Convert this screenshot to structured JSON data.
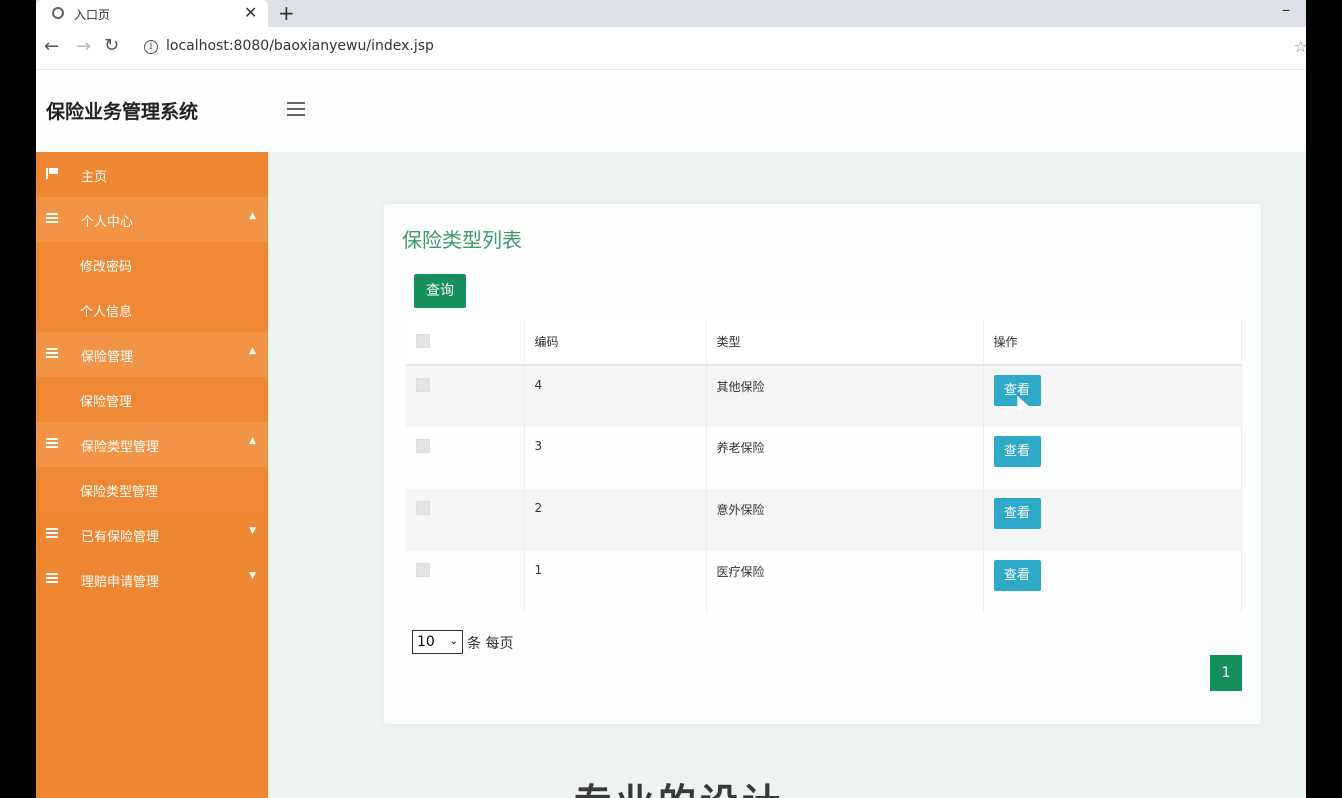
{
  "browser": {
    "tab_title": "入口页",
    "url": "localhost:8080/baoxianyewu/index.jsp"
  },
  "app": {
    "title": "保险业务管理系统"
  },
  "sidebar": {
    "items": [
      {
        "label": "主页",
        "type": "link",
        "icon": "flag-icon"
      },
      {
        "label": "个人中心",
        "type": "parent",
        "icon": "list-icon"
      },
      {
        "label": "修改密码",
        "type": "sub"
      },
      {
        "label": "个人信息",
        "type": "sub"
      },
      {
        "label": "保险管理",
        "type": "parent",
        "icon": "list-icon"
      },
      {
        "label": "保险管理",
        "type": "sub"
      },
      {
        "label": "保险类型管理",
        "type": "parent",
        "icon": "list-icon"
      },
      {
        "label": "保险类型管理",
        "type": "sub"
      },
      {
        "label": "已有保险管理",
        "type": "parent",
        "icon": "list-icon"
      },
      {
        "label": "理赔申请管理",
        "type": "parent",
        "icon": "list-icon"
      }
    ]
  },
  "main": {
    "card_title": "保险类型列表",
    "search_button": "查询",
    "table": {
      "headers": [
        "",
        "编码",
        "类型",
        "操作"
      ],
      "rows": [
        {
          "id": "4",
          "type": "其他保险",
          "action": "查看"
        },
        {
          "id": "3",
          "type": "养老保险",
          "action": "查看"
        },
        {
          "id": "2",
          "type": "意外保险",
          "action": "查看"
        },
        {
          "id": "1",
          "type": "医疗保险",
          "action": "查看"
        }
      ]
    },
    "page_size": "10",
    "page_size_label": "条 每页",
    "current_page": "1",
    "footer_text": "专业的设计"
  },
  "colors": {
    "sidebar": "#ef8732",
    "accent_green": "#15905c",
    "view_button": "#2eaac8",
    "title_green": "#3e9a6a"
  }
}
